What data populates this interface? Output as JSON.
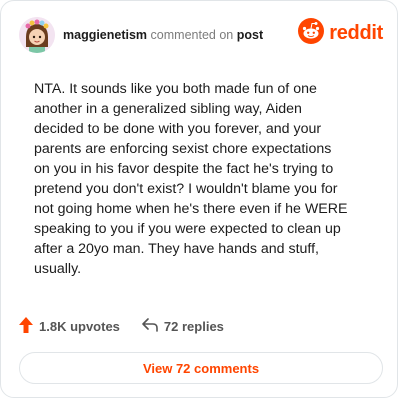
{
  "header": {
    "username": "maggienetism",
    "action_text": "commented on",
    "post_link": "post",
    "brand_name": "reddit",
    "avatar_icon": "cartoon-avatar-icon",
    "brand_icon": "reddit-snoo-icon"
  },
  "comment": {
    "text": "NTA. It sounds like you both made fun of one\nanother in a generalized sibling way, Aiden\ndecided to be done with you forever, and your\nparents are enforcing sexist chore expectations\non you in his favor despite the fact he's trying to\npretend you don't exist? I wouldn't blame you for\nnot going home when he's there even if he WERE\nspeaking to you if you were expected to clean up\nafter a 20yo man. They have hands and stuff,\nusually."
  },
  "stats": {
    "upvotes": "1.8K upvotes",
    "replies": "72 replies",
    "upvote_icon": "upvote-arrow-icon",
    "reply_icon": "reply-arrow-icon"
  },
  "footer": {
    "view_comments_label": "View 72 comments"
  },
  "colors": {
    "brand": "#ff4500",
    "text": "#1c1c1c",
    "muted": "#7c7c7c",
    "border": "#e1e5e8"
  }
}
